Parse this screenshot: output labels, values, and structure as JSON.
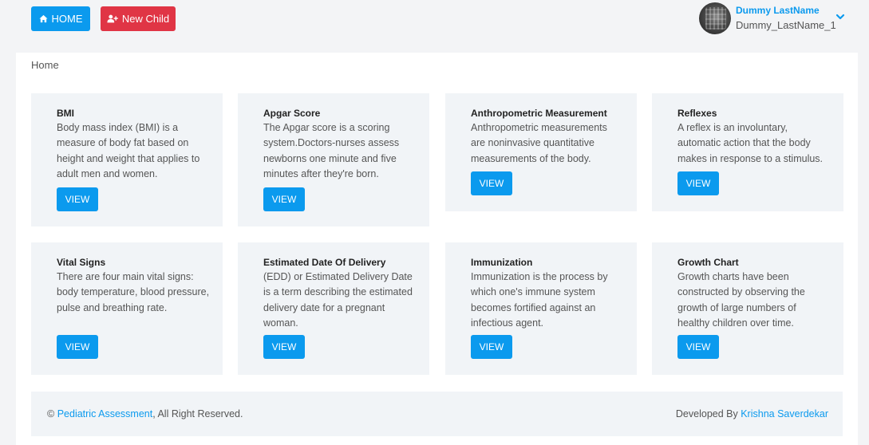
{
  "header": {
    "home_label": "HOME",
    "new_child_label": "New Child",
    "user_name": "Dummy LastName",
    "user_id": "Dummy_LastName_1"
  },
  "breadcrumb": "Home",
  "cards": [
    {
      "title": "BMI",
      "desc": "Body mass index (BMI) is a measure of body fat based on height and weight that applies to adult men and women.",
      "button": "VIEW"
    },
    {
      "title": "Apgar Score",
      "desc": "The Apgar score is a scoring system.Doctors-nurses assess newborns one minute and five minutes after they're born.",
      "button": "VIEW"
    },
    {
      "title": "Anthropometric Measurement",
      "desc": "Anthropometric measurements are noninvasive quantitative measurements of the body.",
      "button": "VIEW"
    },
    {
      "title": "Reflexes",
      "desc": "A reflex is an involuntary, automatic action that the body makes in response to a stimulus.",
      "button": "VIEW"
    },
    {
      "title": "Vital Signs",
      "desc": "There are four main vital signs: body temperature, blood pressure, pulse and breathing rate.",
      "button": "VIEW"
    },
    {
      "title": "Estimated Date Of Delivery",
      "desc": "(EDD) or Estimated Delivery Date is a term describing the estimated delivery date for a pregnant woman.",
      "button": "VIEW"
    },
    {
      "title": "Immunization",
      "desc": "Immunization is the process by which one's immune system becomes fortified against an infectious agent.",
      "button": "VIEW"
    },
    {
      "title": "Growth Chart",
      "desc": "Growth charts have been constructed by observing the growth of large numbers of healthy children over time.",
      "button": "VIEW"
    }
  ],
  "footer": {
    "copyright": "©",
    "app_link": "Pediatric Assessment",
    "rights": ", All Right Reserved.",
    "developed_by": "Developed By",
    "developer_link": "Krishna Saverdekar"
  },
  "colors": {
    "primary": "#0b9aee",
    "danger": "#e03545",
    "card_bg": "#f1f4f7",
    "page_bg": "#f3f4f6"
  },
  "icons": {
    "home_button": "home-icon",
    "new_child_button": "user-plus-icon",
    "user_menu": "chevron-down-icon"
  }
}
